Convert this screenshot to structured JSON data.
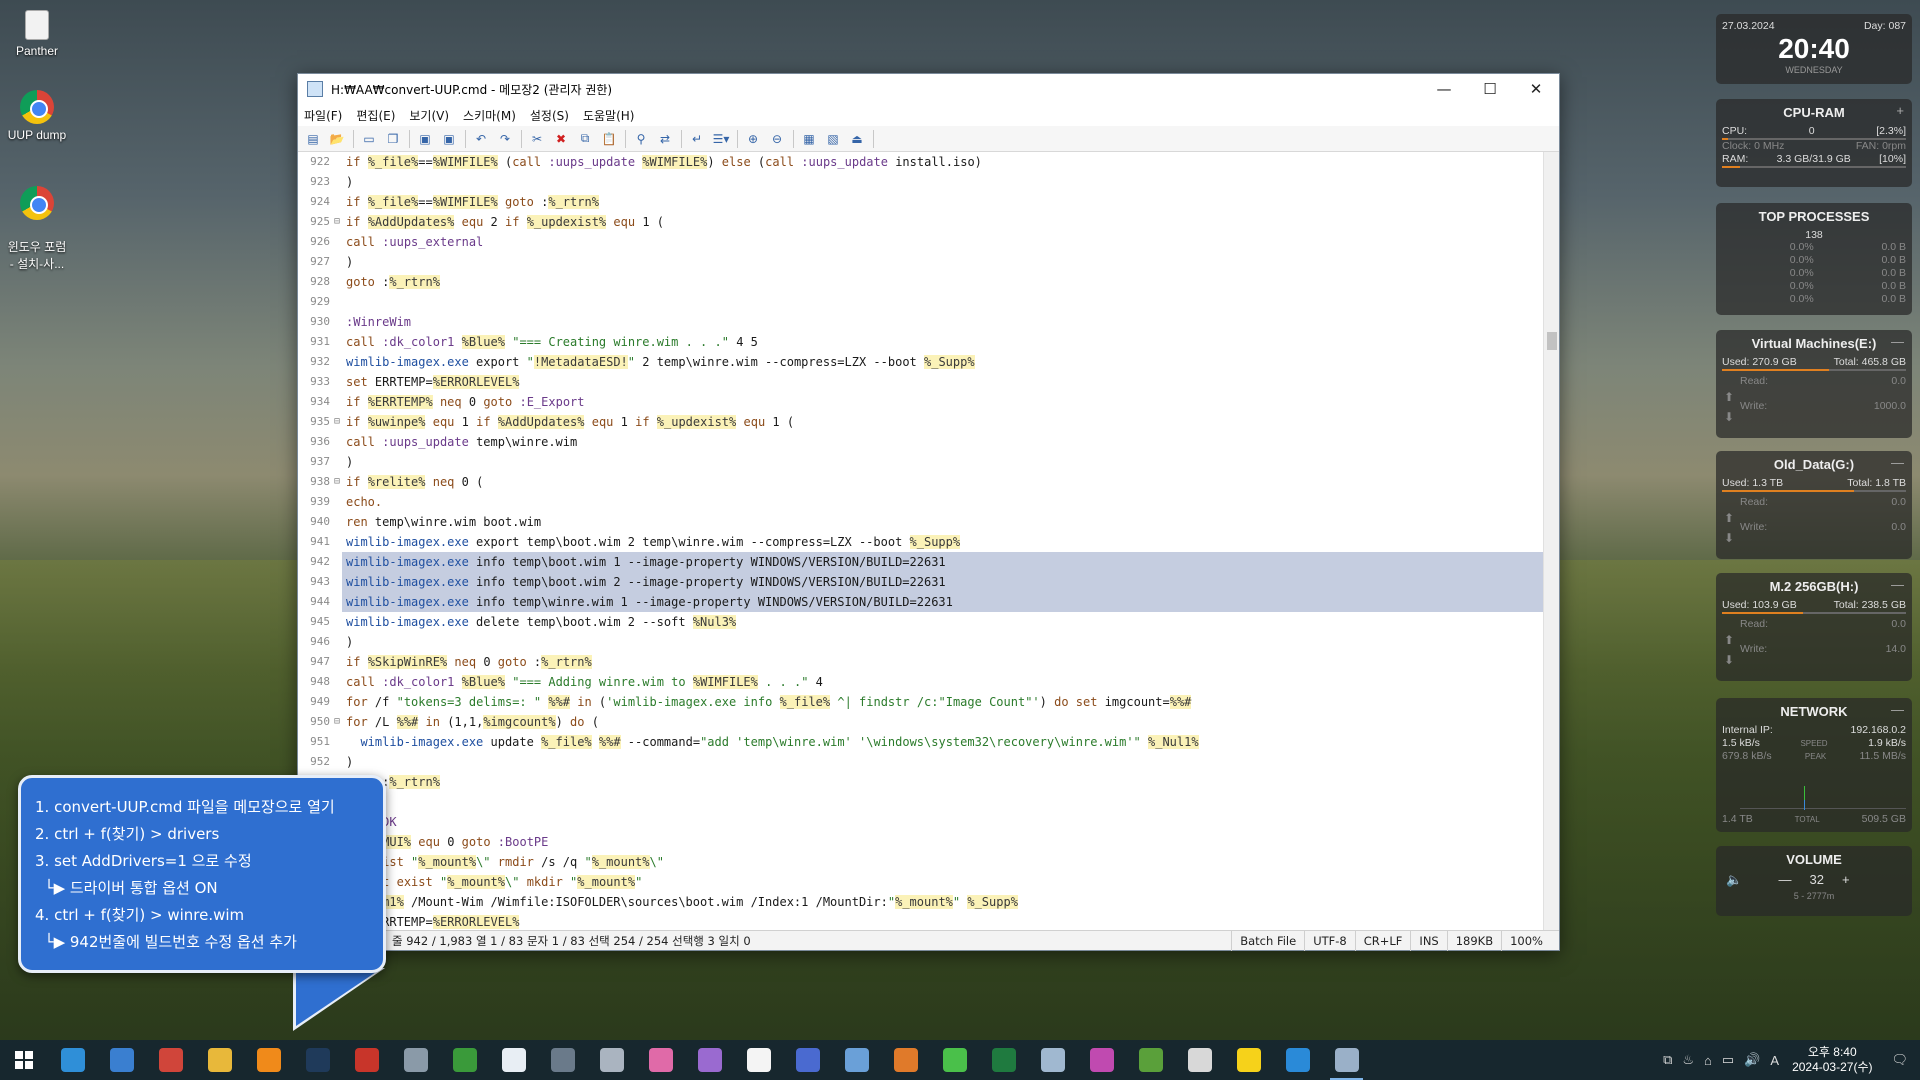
{
  "desktop": {
    "icons": [
      {
        "label": "Panther",
        "type": "file"
      },
      {
        "label": "UUP dump",
        "type": "chrome"
      },
      {
        "label": "윈도우 포럼\n- 설치-사...",
        "type": "chrome"
      }
    ]
  },
  "window": {
    "title": "H:₩AA₩convert-UUP.cmd - 메모장2 (관리자 권한)",
    "menu": [
      "파일(F)",
      "편집(E)",
      "보기(V)",
      "스키마(M)",
      "설정(S)",
      "도움말(H)"
    ],
    "lines": [
      {
        "n": "922",
        "fold": "",
        "sel": false,
        "html": "<span class='kw'>if</span> <span class='var'>%_file%</span>==<span class='var'>%WIMFILE%</span> (<span class='kw'>call</span> <span class='lbl'>:uups_update</span> <span class='var'>%WIMFILE%</span>) <span class='kw'>else</span> (<span class='kw'>call</span> <span class='lbl'>:uups_update</span> install.iso)"
      },
      {
        "n": "923",
        "fold": "",
        "sel": false,
        "html": ")"
      },
      {
        "n": "924",
        "fold": "",
        "sel": false,
        "html": "<span class='kw'>if</span> <span class='var'>%_file%</span>==<span class='var'>%WIMFILE%</span> <span class='kw'>goto</span> :<span class='var'>%_rtrn%</span>"
      },
      {
        "n": "925",
        "fold": "⊟",
        "sel": false,
        "html": "<span class='kw'>if</span> <span class='var'>%AddUpdates%</span> <span class='kw'>equ</span> 2 <span class='kw'>if</span> <span class='var'>%_updexist%</span> <span class='kw'>equ</span> 1 ("
      },
      {
        "n": "926",
        "fold": "",
        "sel": false,
        "html": "<span class='kw'>call</span> <span class='lbl'>:uups_external</span>"
      },
      {
        "n": "927",
        "fold": "",
        "sel": false,
        "html": ")"
      },
      {
        "n": "928",
        "fold": "",
        "sel": false,
        "html": "<span class='kw'>goto</span> :<span class='var'>%_rtrn%</span>"
      },
      {
        "n": "929",
        "fold": "",
        "sel": false,
        "html": ""
      },
      {
        "n": "930",
        "fold": "",
        "sel": false,
        "html": "<span class='lbl'>:WinreWim</span>"
      },
      {
        "n": "931",
        "fold": "",
        "sel": false,
        "html": "<span class='kw'>call</span> <span class='lbl'>:dk_color1</span> <span class='var'>%Blue%</span> <span class='str'>\"=== Creating winre.wim . . .\"</span> 4 5"
      },
      {
        "n": "932",
        "fold": "",
        "sel": false,
        "html": "<span class='exe'>wimlib-imagex.exe</span> export <span class='str'>\"</span><span class='var'>!MetadataESD!</span><span class='str'>\"</span> 2 temp\\winre.wim --compress=LZX --boot <span class='var'>%_Supp%</span>"
      },
      {
        "n": "933",
        "fold": "",
        "sel": false,
        "html": "<span class='kw'>set</span> ERRTEMP=<span class='var'>%ERRORLEVEL%</span>"
      },
      {
        "n": "934",
        "fold": "",
        "sel": false,
        "html": "<span class='kw'>if</span> <span class='var'>%ERRTEMP%</span> <span class='kw'>neq</span> 0 <span class='kw'>goto</span> <span class='lbl'>:E_Export</span>"
      },
      {
        "n": "935",
        "fold": "⊟",
        "sel": false,
        "html": "<span class='kw'>if</span> <span class='var'>%uwinpe%</span> <span class='kw'>equ</span> 1 <span class='kw'>if</span> <span class='var'>%AddUpdates%</span> <span class='kw'>equ</span> 1 <span class='kw'>if</span> <span class='var'>%_updexist%</span> <span class='kw'>equ</span> 1 ("
      },
      {
        "n": "936",
        "fold": "",
        "sel": false,
        "html": "<span class='kw'>call</span> <span class='lbl'>:uups_update</span> temp\\winre.wim"
      },
      {
        "n": "937",
        "fold": "",
        "sel": false,
        "html": ")"
      },
      {
        "n": "938",
        "fold": "⊟",
        "sel": false,
        "html": "<span class='kw'>if</span> <span class='var'>%relite%</span> <span class='kw'>neq</span> 0 ("
      },
      {
        "n": "939",
        "fold": "",
        "sel": false,
        "html": "<span class='kw'>echo.</span>"
      },
      {
        "n": "940",
        "fold": "",
        "sel": false,
        "html": "<span class='kw'>ren</span> temp\\winre.wim boot.wim"
      },
      {
        "n": "941",
        "fold": "",
        "sel": false,
        "html": "<span class='exe'>wimlib-imagex.exe</span> export temp\\boot.wim 2 temp\\winre.wim --compress=LZX --boot <span class='var'>%_Supp%</span>"
      },
      {
        "n": "942",
        "fold": "",
        "sel": true,
        "html": "<span class='exe'>wimlib-imagex.exe</span> info temp\\boot.wim 1 --image-property WINDOWS/VERSION/BUILD=22631"
      },
      {
        "n": "943",
        "fold": "",
        "sel": true,
        "html": "<span class='exe'>wimlib-imagex.exe</span> info temp\\boot.wim 2 --image-property WINDOWS/VERSION/BUILD=22631"
      },
      {
        "n": "944",
        "fold": "",
        "sel": true,
        "html": "<span class='exe'>wimlib-imagex.exe</span> info temp\\winre.wim 1 --image-property WINDOWS/VERSION/BUILD=22631"
      },
      {
        "n": "945",
        "fold": "",
        "sel": false,
        "html": "<span class='exe'>wimlib-imagex.exe</span> delete temp\\boot.wim 2 --soft <span class='var'>%Nul3%</span>"
      },
      {
        "n": "946",
        "fold": "",
        "sel": false,
        "html": ")"
      },
      {
        "n": "947",
        "fold": "",
        "sel": false,
        "html": "<span class='kw'>if</span> <span class='var'>%SkipWinRE%</span> <span class='kw'>neq</span> 0 <span class='kw'>goto</span> :<span class='var'>%_rtrn%</span>"
      },
      {
        "n": "948",
        "fold": "",
        "sel": false,
        "html": "<span class='kw'>call</span> <span class='lbl'>:dk_color1</span> <span class='var'>%Blue%</span> <span class='str'>\"=== Adding winre.wim to </span><span class='var'>%WIMFILE%</span><span class='str'> . . .\"</span> 4"
      },
      {
        "n": "949",
        "fold": "",
        "sel": false,
        "html": "<span class='kw'>for</span> /f <span class='str'>\"tokens=3 delims=: \"</span> <span class='var'>%%#</span> <span class='kw'>in</span> (<span class='str'>'wimlib-imagex.exe info </span><span class='var'>%_file%</span><span class='str'> ^| findstr /c:\"Image Count\"'</span>) <span class='kw'>do</span> <span class='kw'>set</span> imgcount=<span class='var'>%%#</span>"
      },
      {
        "n": "950",
        "fold": "⊟",
        "sel": false,
        "html": "<span class='kw'>for</span> /L <span class='var'>%%#</span> <span class='kw'>in</span> (1,1,<span class='var'>%imgcount%</span>) <span class='kw'>do</span> ("
      },
      {
        "n": "951",
        "fold": "",
        "sel": false,
        "html": "  <span class='exe'>wimlib-imagex.exe</span> update <span class='var'>%_file%</span> <span class='var'>%%#</span> --command=<span class='str'>\"add 'temp\\winre.wim' '\\windows\\system32\\recovery\\winre.wim'\"</span> <span class='var'>%_Nul1%</span>"
      },
      {
        "n": "952",
        "fold": "",
        "sel": false,
        "html": ")"
      },
      {
        "n": "953",
        "fold": "",
        "sel": false,
        "html": "<span class='kw'>goto</span> :<span class='var'>%_rtrn%</span>"
      },
      {
        "n": "954",
        "fold": "",
        "sel": false,
        "html": ""
      },
      {
        "n": "955",
        "fold": "",
        "sel": false,
        "html": "<span class='lbl'>:DoneDK</span>"
      },
      {
        "n": "956",
        "fold": "",
        "sel": false,
        "html": "<span class='kw'>if</span> <span class='var'>%_MUI%</span> <span class='kw'>equ</span> 0 <span class='kw'>goto</span> <span class='lbl'>:BootPE</span>"
      },
      {
        "n": "957",
        "fold": "",
        "sel": false,
        "html": "<span class='kw'>if</span> <span class='kw'>exist</span> <span class='str'>\"</span><span class='var'>%_mount%</span><span class='str'>\\\"</span> <span class='kw'>rmdir</span> /s /q <span class='str'>\"</span><span class='var'>%_mount%</span><span class='str'>\\\"</span>"
      },
      {
        "n": "958",
        "fold": "",
        "sel": false,
        "html": "<span class='kw'>if</span> <span class='kw'>not</span> <span class='kw'>exist</span> <span class='str'>\"</span><span class='var'>%_mount%</span><span class='str'>\\\"</span> <span class='kw'>mkdir</span> <span class='str'>\"</span><span class='var'>%_mount%</span><span class='str'>\"</span>"
      },
      {
        "n": "959",
        "fold": "",
        "sel": false,
        "html": "<span class='var'>%_dism1%</span> /Mount-Wim /Wimfile:ISOFOLDER\\sources\\boot.wim /Index:1 /MountDir:<span class='str'>\"</span><span class='var'>%_mount%</span><span class='str'>\"</span> <span class='var'>%_Supp%</span>"
      },
      {
        "n": "960",
        "fold": "",
        "sel": false,
        "html": "<span class='kw'>set</span> ERRTEMP=<span class='var'>%ERRORLEVEL%</span>"
      }
    ],
    "status": {
      "position": "줄 942 / 1,983  열 1 / 83  문자 1 / 83  선택 254 / 254  선택행 3  일치 0",
      "filetype": "Batch File",
      "encoding": "UTF-8",
      "eol": "CR+LF",
      "mode": "INS",
      "size": "189KB",
      "zoom": "100%"
    }
  },
  "callout": {
    "steps": [
      "1. convert-UUP.cmd 파일을 메모장으로 열기",
      "2. ctrl + f(찾기) > drivers",
      "3. set AddDrivers=1 으로 수정",
      "  └▶ 드라이버 통합 옵션 ON",
      "4. ctrl + f(찾기) > winre.wim",
      "  └▶ 942번줄에 빌드번호 수정 옵션 추가"
    ]
  },
  "widgets": {
    "clock": {
      "date": "27.03.2024",
      "day": "Day: 087",
      "time": "20:40",
      "weekday": "WEDNESDAY"
    },
    "cpuram": {
      "title": "CPU-RAM",
      "cpu_label": "CPU:",
      "cpu_value": "0",
      "cpu_pct": "[2.3%]",
      "clock": "Clock: 0 MHz",
      "fan": "FAN: 0rpm",
      "ram_label": "RAM:",
      "ram_value": "3.3 GB/31.9 GB",
      "ram_pct": "[10%]",
      "ram_fraction": 0.1
    },
    "processes": {
      "title": "TOP PROCESSES",
      "count": "138",
      "rows": [
        [
          "0.0%",
          "0.0 B"
        ],
        [
          "0.0%",
          "0.0 B"
        ],
        [
          "0.0%",
          "0.0 B"
        ],
        [
          "0.0%",
          "0.0 B"
        ],
        [
          "0.0%",
          "0.0 B"
        ]
      ]
    },
    "drives": [
      {
        "title": "Virtual Machines(E:)",
        "used": "Used: 270.9 GB",
        "total": "Total: 465.8 GB",
        "read": "Read:",
        "read_v": "0.0",
        "write": "Write:",
        "write_v": "1000.0",
        "fraction": 0.58
      },
      {
        "title": "Old_Data(G:)",
        "used": "Used: 1.3 TB",
        "total": "Total: 1.8 TB",
        "read": "Read:",
        "read_v": "0.0",
        "write": "Write:",
        "write_v": "0.0",
        "fraction": 0.72
      },
      {
        "title": "M.2 256GB(H:)",
        "used": "Used: 103.9 GB",
        "total": "Total: 238.5 GB",
        "read": "Read:",
        "read_v": "0.0",
        "write": "Write:",
        "write_v": "14.0",
        "fraction": 0.44
      }
    ],
    "network": {
      "title": "NETWORK",
      "ip_label": "Internal IP:",
      "ip": "192.168.0.2",
      "up": "1.5 kB/s",
      "speed": "SPEED",
      "down": "1.9 kB/s",
      "up2": "679.8 kB/s",
      "peak": "PEAK",
      "down2": "11.5 MB/s",
      "total_l": "1.4 TB",
      "total": "TOTAL",
      "total_r": "509.5 GB"
    },
    "volume": {
      "title": "VOLUME",
      "value": "32",
      "device": "5 - 2777m"
    }
  },
  "taskbar": {
    "time": "오후 8:40",
    "date": "2024-03-27(수)",
    "apps": [
      {
        "name": "edge",
        "color": "#2f8fd8"
      },
      {
        "name": "internet-explorer",
        "color": "#3a7fd0"
      },
      {
        "name": "chrome",
        "color": "#d0453a"
      },
      {
        "name": "file-explorer",
        "color": "#e8b83a"
      },
      {
        "name": "avast",
        "color": "#f08a1a"
      },
      {
        "name": "photoshop",
        "color": "#1f3a5a"
      },
      {
        "name": "app-red",
        "color": "#c8352a"
      },
      {
        "name": "app-tools",
        "color": "#8a9aa8"
      },
      {
        "name": "app-green",
        "color": "#3a9a3a"
      },
      {
        "name": "notepad2",
        "color": "#e8eef4"
      },
      {
        "name": "app-circle",
        "color": "#6a7a8a"
      },
      {
        "name": "app-diamond",
        "color": "#aab4c0"
      },
      {
        "name": "app-pink",
        "color": "#e06aa8"
      },
      {
        "name": "app-purple",
        "color": "#9a6ad0"
      },
      {
        "name": "app-d",
        "color": "#f4f4f4"
      },
      {
        "name": "app-blue",
        "color": "#4a6ad0"
      },
      {
        "name": "app-cloud",
        "color": "#6aa0d8"
      },
      {
        "name": "app-orange",
        "color": "#e07a2a"
      },
      {
        "name": "app-leaf",
        "color": "#4ac04a"
      },
      {
        "name": "excel",
        "color": "#1f7a3f"
      },
      {
        "name": "app-page",
        "color": "#a0b8d0"
      },
      {
        "name": "app-disc",
        "color": "#c04ab0"
      },
      {
        "name": "app-utorrent",
        "color": "#5aa03a"
      },
      {
        "name": "app-monitor",
        "color": "#d8d8d8"
      },
      {
        "name": "kakaotalk",
        "color": "#f6d21a"
      },
      {
        "name": "app-window",
        "color": "#2a8ad8"
      },
      {
        "name": "notepad-active",
        "color": "#9ab0c8"
      }
    ]
  }
}
